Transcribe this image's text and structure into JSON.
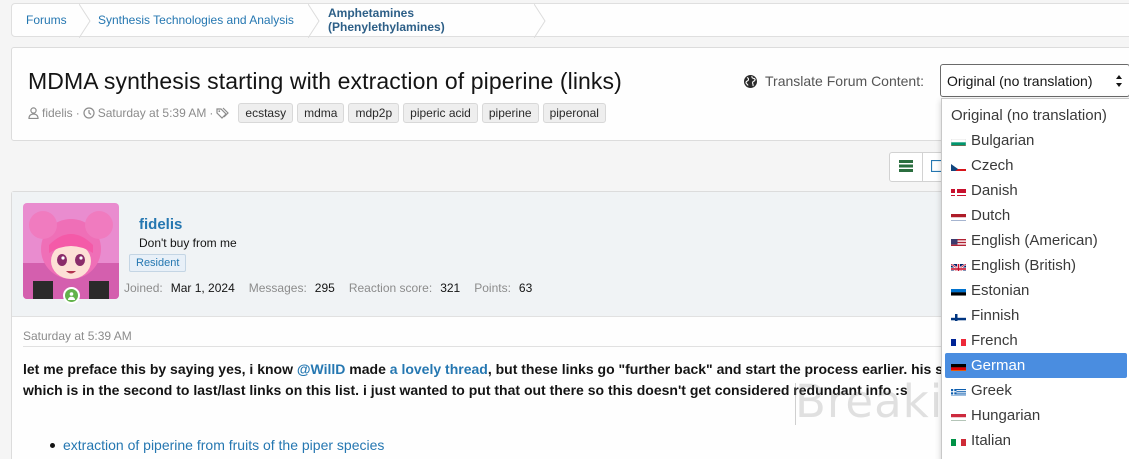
{
  "breadcrumb": [
    "Forums",
    "Synthesis Technologies and Analysis",
    "Amphetamines (Phenylethylamines)"
  ],
  "thread": {
    "title": "MDMA synthesis starting with extraction of piperine (links)",
    "author": "fidelis",
    "date": "Saturday at 5:39 AM",
    "tags": [
      "ecstasy",
      "mdma",
      "mdp2p",
      "piperic acid",
      "piperine",
      "piperonal"
    ]
  },
  "translate": {
    "label": "Translate Forum Content:",
    "selected": "Original (no translation)",
    "options": [
      {
        "label": "Original (no translation)",
        "flag": ""
      },
      {
        "label": "Bulgarian",
        "flag": "bg"
      },
      {
        "label": "Czech",
        "flag": "cz"
      },
      {
        "label": "Danish",
        "flag": "dk"
      },
      {
        "label": "Dutch",
        "flag": "nl"
      },
      {
        "label": "English (American)",
        "flag": "us"
      },
      {
        "label": "English (British)",
        "flag": "gb"
      },
      {
        "label": "Estonian",
        "flag": "ee"
      },
      {
        "label": "Finnish",
        "flag": "fi"
      },
      {
        "label": "French",
        "flag": "fr"
      },
      {
        "label": "German",
        "flag": "de"
      },
      {
        "label": "Greek",
        "flag": "gr"
      },
      {
        "label": "Hungarian",
        "flag": "hu"
      },
      {
        "label": "Italian",
        "flag": "it"
      }
    ],
    "highlighted": "German"
  },
  "post": {
    "username": "fidelis",
    "user_title": "Don't buy from me",
    "badge": "Resident",
    "stats": [
      {
        "k": "Joined:",
        "v": "Mar 1, 2024"
      },
      {
        "k": "Messages:",
        "v": "295"
      },
      {
        "k": "Reaction score:",
        "v": "321"
      },
      {
        "k": "Points:",
        "v": "63"
      }
    ],
    "date": "Saturday at 5:39 AM",
    "text_a": "let me preface this by saying yes, i know ",
    "mention": "@WillD",
    "text_b": " made ",
    "thread_link": "a lovely thread",
    "text_c": ", but these links go \"further back\" and start the process earlier. his s",
    "line2": "which is in the second to last/last links on this list. i just wanted to put that out there so this doesn't get considered redundant info :s",
    "list_item": "extraction of piperine from fruits of the piper species"
  },
  "watermark": "BreakingBad",
  "colors": {
    "link": "#2577b1",
    "highlight": "#4a8de0",
    "online": "#63b34b"
  }
}
